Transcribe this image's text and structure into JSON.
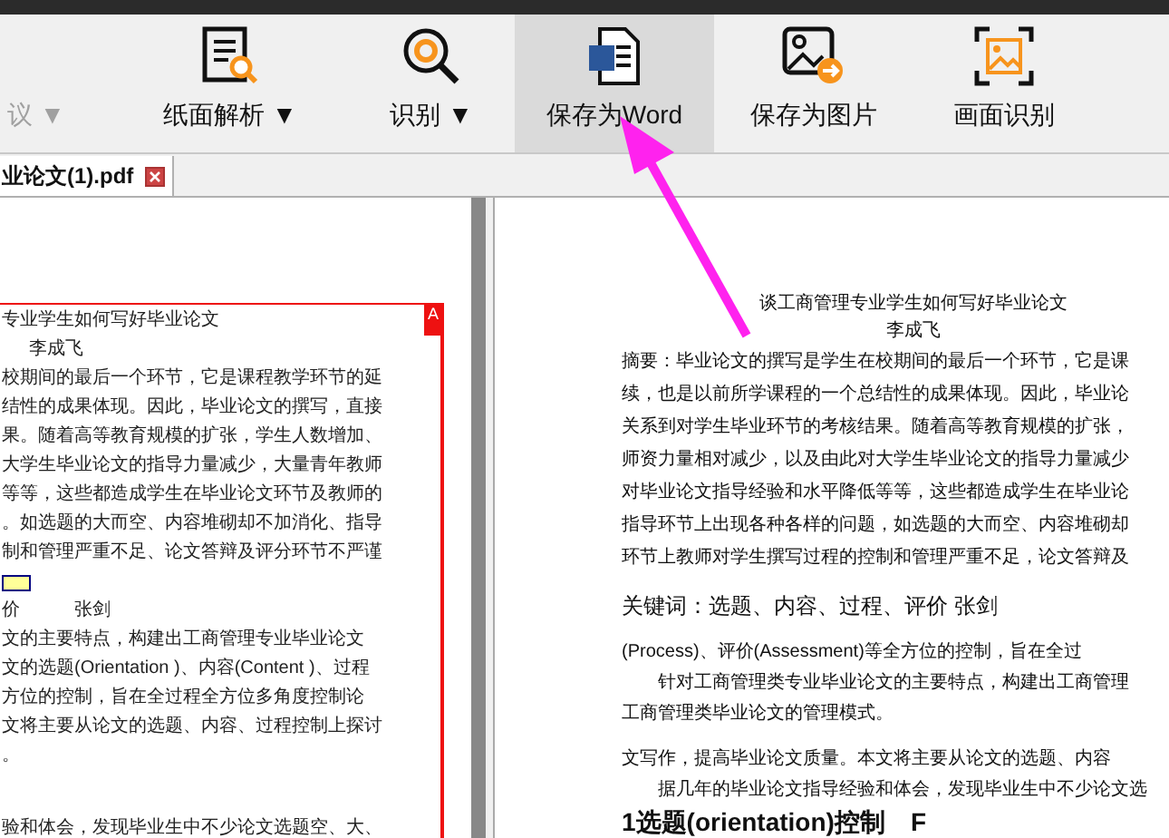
{
  "toolbar": {
    "items": [
      {
        "label": "议",
        "caret": "▼",
        "disabled": true,
        "selected": false
      },
      {
        "label": "纸面解析",
        "caret": "▼",
        "disabled": false,
        "selected": false
      },
      {
        "label": "识别",
        "caret": "▼",
        "disabled": false,
        "selected": false
      },
      {
        "label": "保存为Word",
        "disabled": false,
        "selected": true
      },
      {
        "label": "保存为图片",
        "disabled": false,
        "selected": false
      },
      {
        "label": "画面识别",
        "disabled": false,
        "selected": false
      }
    ]
  },
  "tabs": [
    {
      "label": "业论文(1).pdf",
      "selected": true
    }
  ],
  "left_page": {
    "annotation_mark": "A",
    "lines": [
      {
        "kind": "text",
        "text": "专业学生如何写好毕业论文"
      },
      {
        "kind": "author",
        "text": "李成飞"
      },
      {
        "kind": "text",
        "text": "校期间的最后一个环节，它是课程教学环节的延"
      },
      {
        "kind": "text",
        "text": "结性的成果体现。因此，毕业论文的撰写，直接"
      },
      {
        "kind": "text",
        "text": "果。随着高等教育规模的扩张，学生人数增加、"
      },
      {
        "kind": "text",
        "text": "大学生毕业论文的指导力量减少，大量青年教师"
      },
      {
        "kind": "text",
        "text": "等等，这些都造成学生在毕业论文环节及教师的"
      },
      {
        "kind": "text",
        "text": "。如选题的大而空、内容堆砌却不加消化、指导"
      },
      {
        "kind": "text",
        "text": "制和管理严重不足、论文答辩及评分环节不严谨"
      },
      {
        "kind": "note"
      },
      {
        "kind": "text",
        "text": "价　　　张剑"
      },
      {
        "kind": "text",
        "text": "文的主要特点，构建出工商管理专业毕业论文"
      },
      {
        "kind": "text",
        "text": "文的选题(Orientation )、内容(Content )、过程"
      },
      {
        "kind": "text",
        "text": "方位的控制，旨在全过程全方位多角度控制论"
      },
      {
        "kind": "text",
        "text": "文将主要从论文的选题、内容、过程控制上探讨"
      },
      {
        "kind": "text",
        "text": "。"
      },
      {
        "kind": "gap"
      },
      {
        "kind": "text",
        "text": "验和体会，发现毕业生中不少论文选题空、大、"
      }
    ]
  },
  "right_page": {
    "lines": [
      {
        "kind": "title",
        "text": "谈工商管理专业学生如何写好毕业论文"
      },
      {
        "kind": "author",
        "text": "李成飞"
      },
      {
        "kind": "text",
        "text": "摘要：毕业论文的撰写是学生在校期间的最后一个环节，它是课"
      },
      {
        "kind": "text",
        "text": "续，也是以前所学课程的一个总结性的成果体现。因此，毕业论"
      },
      {
        "kind": "text",
        "text": "关系到对学生毕业环节的考核结果。随着高等教育规模的扩张，"
      },
      {
        "kind": "text",
        "text": "师资力量相对减少，以及由此对大学生毕业论文的指导力量减少"
      },
      {
        "kind": "text",
        "text": "对毕业论文指导经验和水平降低等等，这些都造成学生在毕业论"
      },
      {
        "kind": "text",
        "text": "指导环节上出现各种各样的问题，如选题的大而空、内容堆砌却"
      },
      {
        "kind": "text",
        "text": "环节上教师对学生撰写过程的控制和管理严重不足，论文答辩及"
      },
      {
        "kind": "gap"
      },
      {
        "kind": "keywords",
        "text": "关键词：选题、内容、过程、评价 张剑"
      },
      {
        "kind": "gap"
      },
      {
        "kind": "text",
        "text": "(Process)、评价(Assessment)等全方位的控制，旨在全过"
      },
      {
        "kind": "indent",
        "text": "针对工商管理类专业毕业论文的主要特点，构建出工商管理"
      },
      {
        "kind": "text",
        "text": "工商管理类毕业论文的管理模式。"
      },
      {
        "kind": "gap"
      },
      {
        "kind": "text",
        "text": "文写作，提高毕业论文质量。本文将主要从论文的选题、内容"
      },
      {
        "kind": "indent",
        "text": "据几年的毕业论文指导经验和体会，发现毕业生中不少论文选"
      },
      {
        "kind": "heading",
        "text": "1选题(orientation)控制　F"
      }
    ]
  }
}
